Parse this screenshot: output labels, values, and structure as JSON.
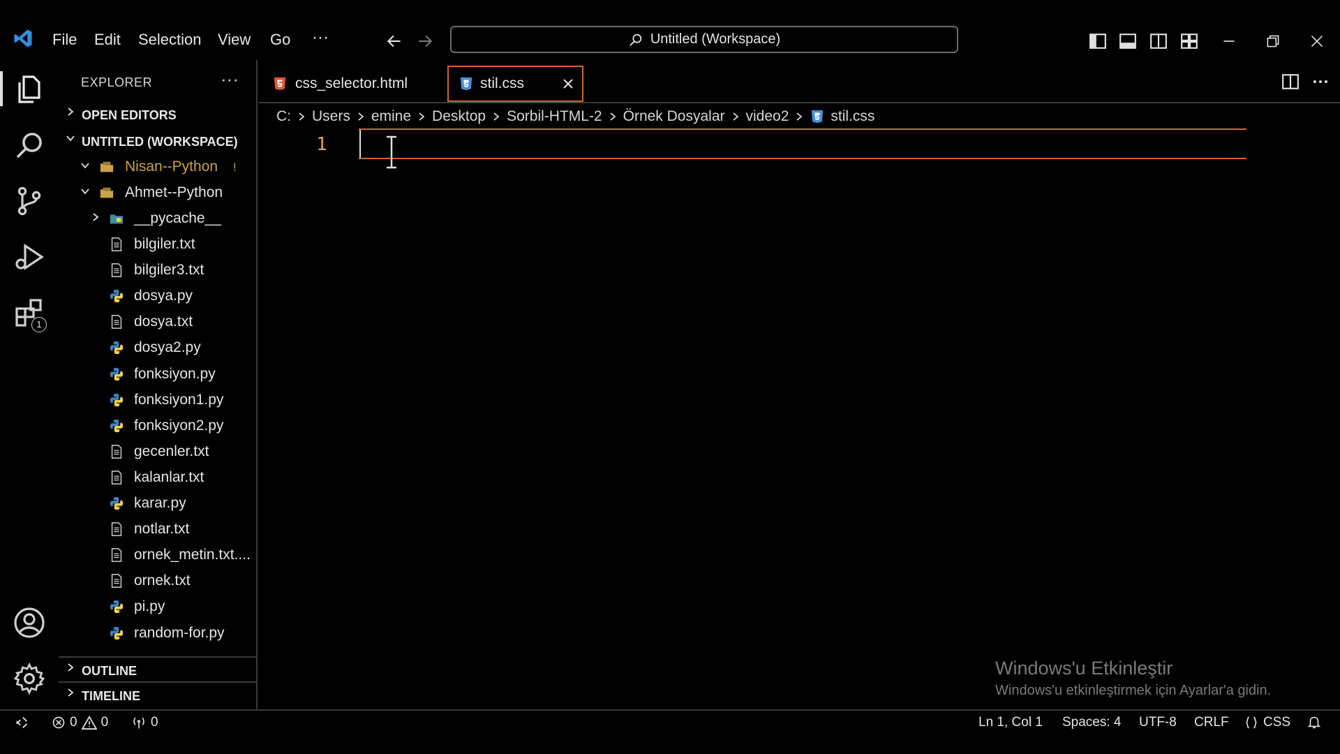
{
  "menu": [
    "File",
    "Edit",
    "Selection",
    "View",
    "Go",
    "···"
  ],
  "command_center": "Untitled (Workspace)",
  "explorer": {
    "header": "EXPLORER",
    "more": "···",
    "open_editors": "OPEN EDITORS",
    "workspace": "UNTITLED (WORKSPACE)",
    "folder1": {
      "name": "Nisan--Python",
      "badge": "!"
    },
    "folder2": {
      "name": "Ahmet--Python"
    },
    "pycache": "__pycache__",
    "files": [
      {
        "name": "bilgiler.txt",
        "type": "txt"
      },
      {
        "name": "bilgiler3.txt",
        "type": "txt"
      },
      {
        "name": "dosya.py",
        "type": "py"
      },
      {
        "name": "dosya.txt",
        "type": "txt"
      },
      {
        "name": "dosya2.py",
        "type": "py"
      },
      {
        "name": "fonksiyon.py",
        "type": "py"
      },
      {
        "name": "fonksiyon1.py",
        "type": "py"
      },
      {
        "name": "fonksiyon2.py",
        "type": "py"
      },
      {
        "name": "gecenler.txt",
        "type": "txt"
      },
      {
        "name": "kalanlar.txt",
        "type": "txt"
      },
      {
        "name": "karar.py",
        "type": "py"
      },
      {
        "name": "notlar.txt",
        "type": "txt"
      },
      {
        "name": "ornek_metin.txt....",
        "type": "txt"
      },
      {
        "name": "ornek.txt",
        "type": "txt"
      },
      {
        "name": "pi.py",
        "type": "py"
      },
      {
        "name": "random-for.py",
        "type": "py"
      }
    ],
    "outline": "OUTLINE",
    "timeline": "TIMELINE"
  },
  "tabs": [
    {
      "label": "css_selector.html",
      "icon": "html5-icon"
    },
    {
      "label": "stil.css",
      "icon": "css3-icon",
      "active": true
    }
  ],
  "breadcrumb": [
    "C:",
    "Users",
    "emine",
    "Desktop",
    "Sorbil-HTML-2",
    "Örnek Dosyalar",
    "video2",
    "stil.css"
  ],
  "editor": {
    "line_number": "1"
  },
  "extensions_badge": "1",
  "watermark": {
    "title": "Windows'u Etkinleştir",
    "subtitle": "Windows'u etkinleştirmek için Ayarlar'a gidin."
  },
  "status": {
    "errors": "0",
    "warnings": "0",
    "ports": "0",
    "position": "Ln 1, Col 1",
    "spaces": "Spaces: 4",
    "encoding": "UTF-8",
    "eol": "CRLF",
    "language": "CSS"
  },
  "colors": {
    "accent": "#c8693a",
    "folder_modified": "#c9a24a",
    "css_icon": "#4a8fd8",
    "html_icon": "#e0563a",
    "python_yellow": "#f2d14a",
    "python_blue": "#3b82c4",
    "vscode_blue": "#2f8fe0"
  }
}
